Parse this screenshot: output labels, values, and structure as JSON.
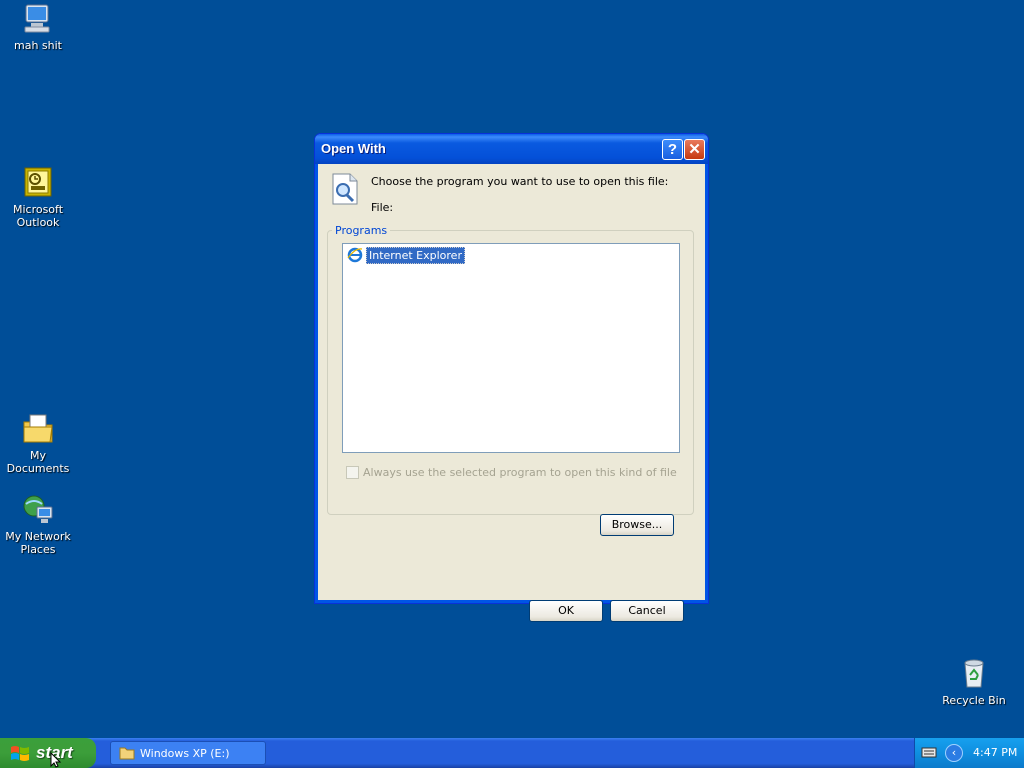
{
  "desktop": {
    "icons": [
      {
        "id": "my-computer",
        "label": "mah shit"
      },
      {
        "id": "outlook",
        "label": "Microsoft Outlook"
      },
      {
        "id": "my-documents",
        "label": "My Documents"
      },
      {
        "id": "network-places",
        "label": "My Network Places"
      },
      {
        "id": "recycle-bin",
        "label": "Recycle Bin"
      }
    ]
  },
  "dialog": {
    "title": "Open With",
    "help_button": "?",
    "close_button": "✕",
    "prompt": "Choose the program you want to use to open this file:",
    "file_label": "File:",
    "programs_group": "Programs",
    "programs": [
      {
        "name": "Internet Explorer",
        "selected": true
      }
    ],
    "always_use_label": "Always use the selected program to open this kind of file",
    "always_use_checked": false,
    "browse_button": "Browse...",
    "ok_button": "OK",
    "cancel_button": "Cancel"
  },
  "taskbar": {
    "start_label": "start",
    "tasks": [
      {
        "label": "Windows XP (E:)"
      }
    ],
    "clock": "4:47 PM"
  },
  "colors": {
    "desktop": "#004e98",
    "selection": "#316ac5",
    "taskbar": "#245edb",
    "start": "#3c9e3a"
  }
}
